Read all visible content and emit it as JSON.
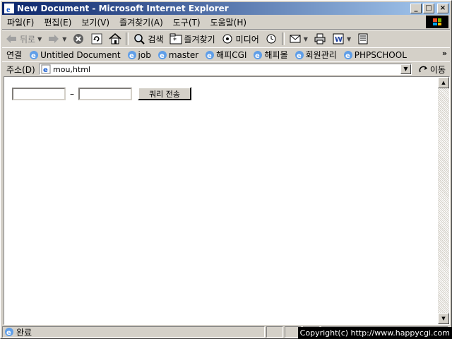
{
  "window": {
    "title": "New Document - Microsoft Internet Explorer"
  },
  "menu": [
    "파일(F)",
    "편집(E)",
    "보기(V)",
    "즐겨찾기(A)",
    "도구(T)",
    "도움말(H)"
  ],
  "toolbar": {
    "back_label": "뒤로",
    "search_label": "검색",
    "favorites_label": "즐겨찾기",
    "media_label": "미디어"
  },
  "links": {
    "label": "연결",
    "items": [
      "Untitled Document",
      "job",
      "master",
      "해피CGI",
      "해피몰",
      "회원관리",
      "PHPSCHOOL"
    ]
  },
  "address": {
    "label": "주소(D)",
    "url": "mou,html",
    "go_label": "이동"
  },
  "form": {
    "field1_value": "",
    "field2_value": "",
    "separator": "–",
    "submit_label": "쿼리 전송"
  },
  "status": {
    "text": "완료"
  },
  "watermark": "Copyright(c) http://www.happycgi.com"
}
